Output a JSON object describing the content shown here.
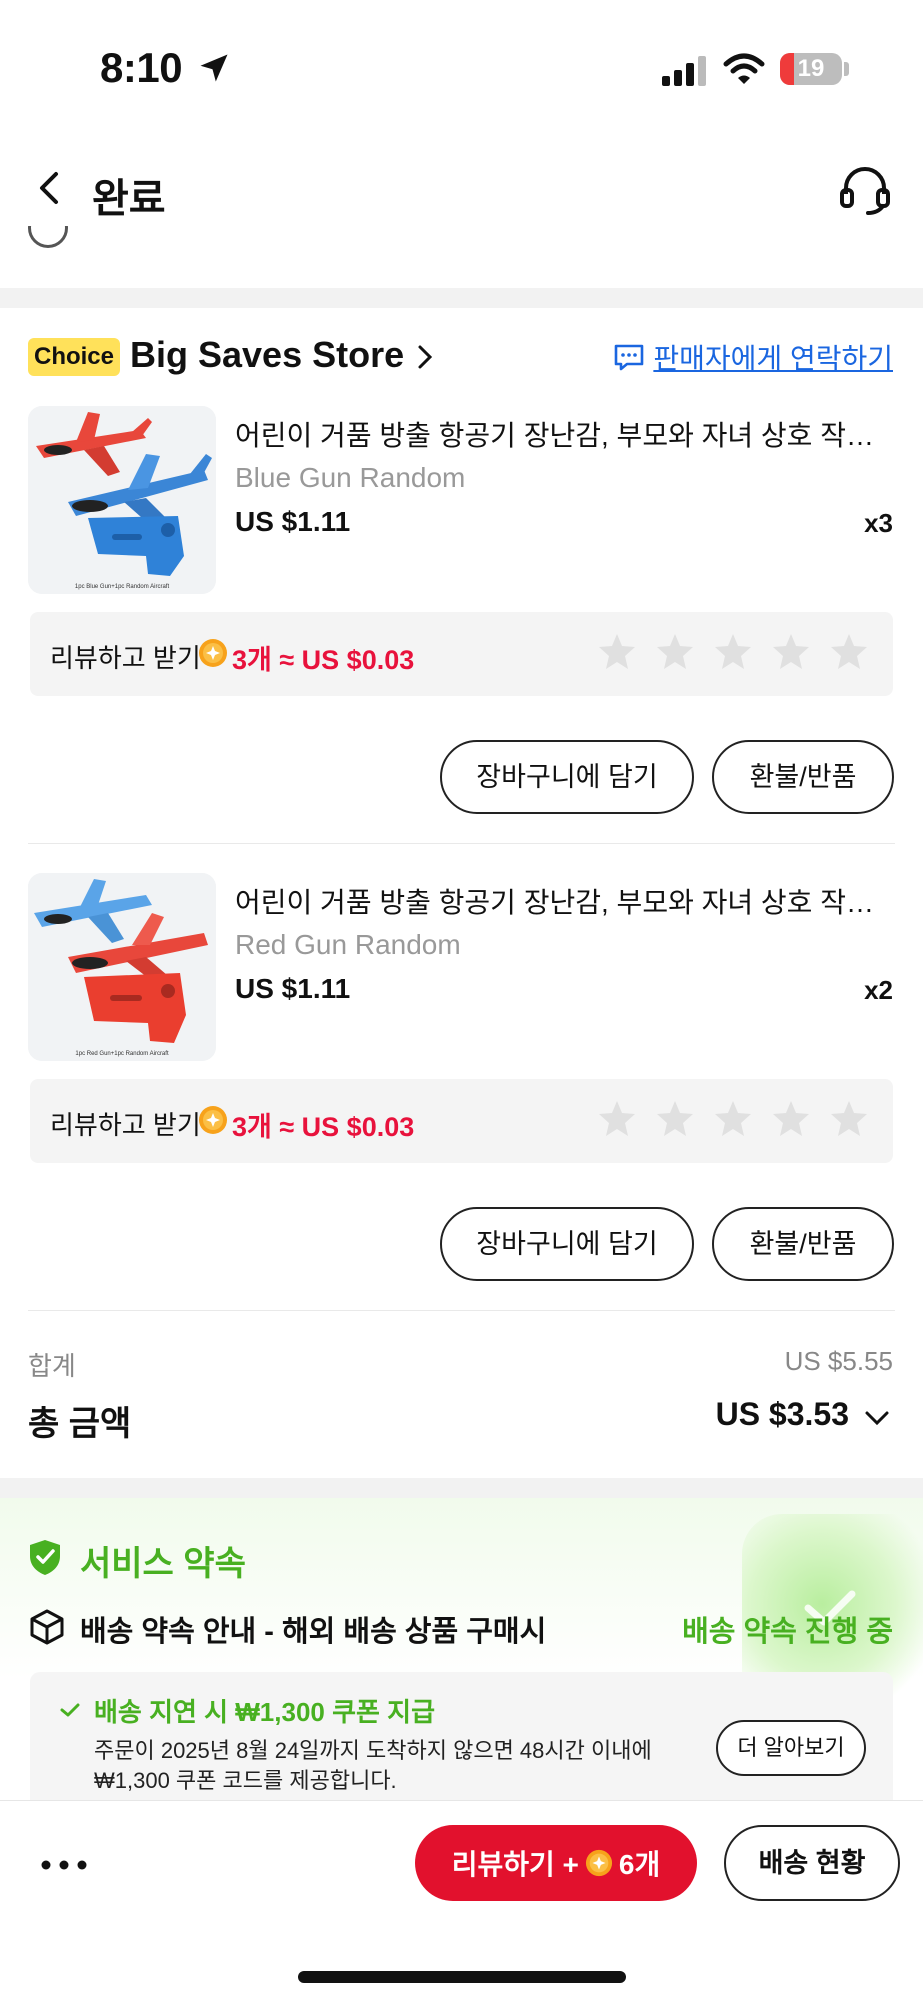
{
  "status_bar": {
    "time": "8:10",
    "battery": "19",
    "icons": [
      "location-arrow-icon",
      "cellular-signal-icon",
      "wifi-icon",
      "battery-icon"
    ]
  },
  "header": {
    "title": "완료",
    "icons": [
      "back-chevron-icon",
      "customer-support-headset-icon"
    ]
  },
  "store": {
    "badge": "Choice",
    "name": "Big Saves Store",
    "contact_label": "판매자에게 연락하기"
  },
  "items": [
    {
      "title": "어린이 거품 방출 항공기 장난감, 부모와 자녀 상호 작용, 야외 스포츠 글라이더",
      "variant": "Blue Gun Random",
      "price": "US $1.11",
      "qty": "x3",
      "thumb_caption": "1pc Blue Gun+1pc Random Aircraft",
      "review_label": "리뷰하고 받기",
      "review_reward": "3개 ≈ US $0.03",
      "rating": 0,
      "add_to_cart": "장바구니에 담기",
      "refund": "환불/반품"
    },
    {
      "title": "어린이 거품 방출 항공기 장난감, 부모와 자녀 상호 작용, 야외 스포츠 글라이더",
      "variant": "Red Gun Random",
      "price": "US $1.11",
      "qty": "x2",
      "thumb_caption": "1pc Red Gun+1pc Random Aircraft",
      "review_label": "리뷰하고 받기",
      "review_reward": "3개 ≈ US $0.03",
      "rating": 0,
      "add_to_cart": "장바구니에 담기",
      "refund": "환불/반품"
    }
  ],
  "totals": {
    "subtotal_label": "합계",
    "subtotal_value": "US $5.55",
    "total_label": "총 금액",
    "total_value": "US $3.53"
  },
  "service": {
    "title": "서비스 약속",
    "shipping_title": "배송 약속 안내 - 해외 배송 상품 구매시",
    "shipping_status": "배송 약속 진행 중",
    "guarantee_title": "배송 지연 시 ₩1,300 쿠폰 지급",
    "guarantee_desc": "주문이 2025년 8월 24일까지 도착하지 않으면 48시간 이내에 ₩1,300 쿠폰 코드를 제공합니다.",
    "learn_more": "더 알아보기"
  },
  "bottom_bar": {
    "review_button_prefix": "리뷰하기 +",
    "review_button_suffix": "6개",
    "track_button": "배송 현황"
  },
  "colors": {
    "accent_red": "#e2112d",
    "price_red": "#e8123c",
    "link_blue": "#1a66e0",
    "success_green": "#48b021",
    "choice_yellow": "#ffe15a",
    "coin_orange": "#f7a21b"
  }
}
